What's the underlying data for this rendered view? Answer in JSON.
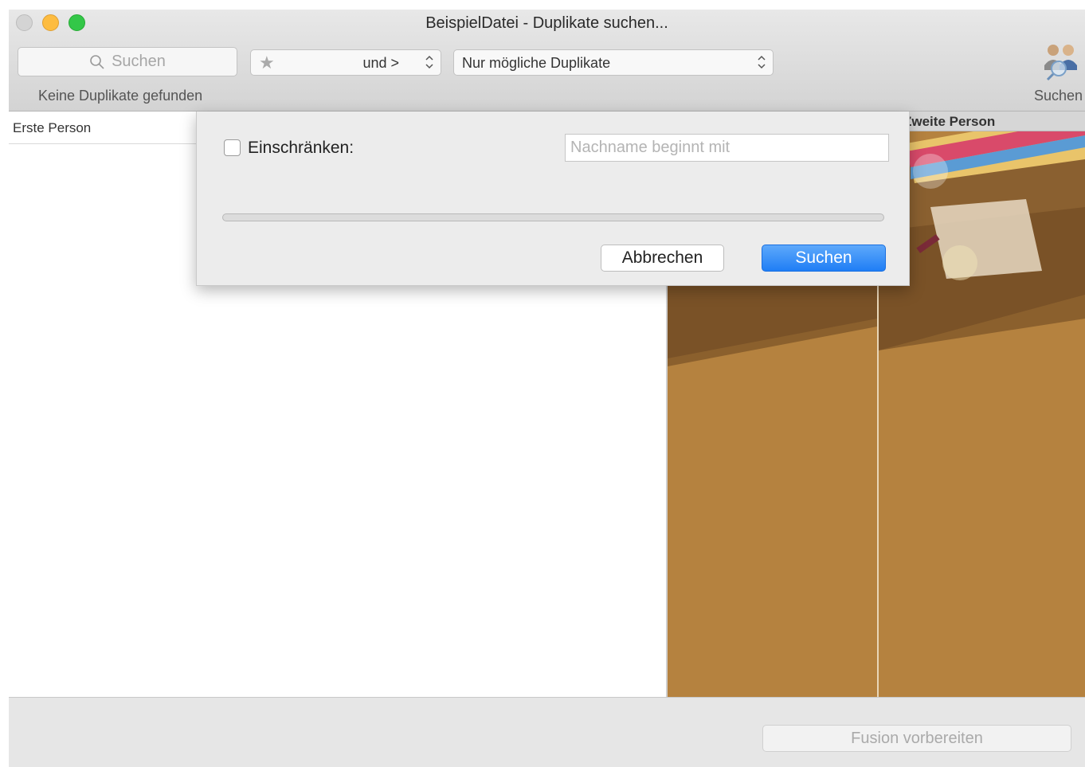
{
  "window": {
    "title": "BeispielDatei - Duplikate suchen..."
  },
  "toolbar": {
    "search_placeholder": "Suchen",
    "filter_popup_label": "und >",
    "mode_popup_label": "Nur mögliche Duplikate",
    "status": "Keine Duplikate gefunden",
    "find_button_label": "Suchen"
  },
  "list": {
    "column_header": "Erste Person"
  },
  "detail": {
    "second_person_header": "Zweite Person"
  },
  "footer": {
    "merge_button_label": "Fusion vorbereiten"
  },
  "sheet": {
    "restrict_label": "Einschränken:",
    "restrict_checked": false,
    "lastname_placeholder": "Nachname beginnt mit",
    "lastname_value": "",
    "progress": 0,
    "cancel_label": "Abbrechen",
    "search_label": "Suchen"
  },
  "colors": {
    "accent": "#1f7ef5",
    "wood": "#b5823f"
  }
}
